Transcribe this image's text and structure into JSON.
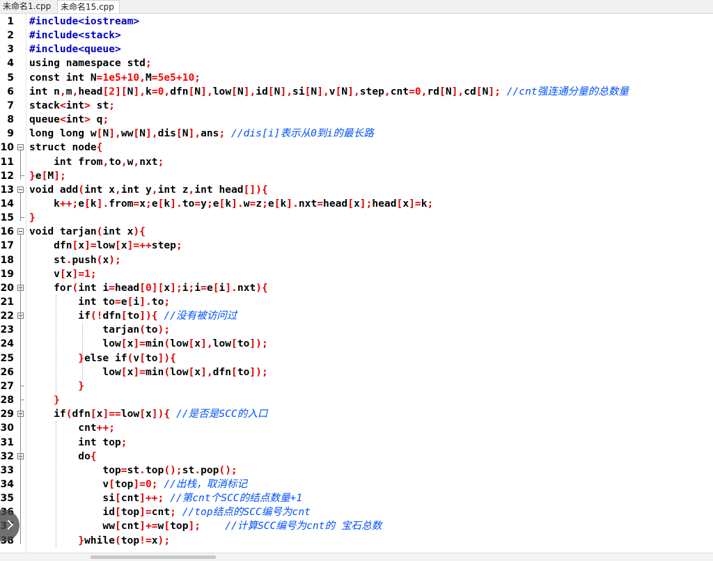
{
  "tabs": [
    "未命名1.cpp",
    "未命名15.cpp"
  ],
  "lines": [
    [
      [
        "p",
        "#include<iostream>"
      ]
    ],
    [
      [
        "p",
        "#include<stack>"
      ]
    ],
    [
      [
        "p",
        "#include<queue>"
      ]
    ],
    [
      [
        "k",
        "using namespace std"
      ],
      [
        "o",
        ";"
      ]
    ],
    [
      [
        "k",
        "const int "
      ],
      [
        "k",
        "N"
      ],
      [
        "o",
        "="
      ],
      [
        "n",
        "1e5+10"
      ],
      [
        "o",
        ","
      ],
      [
        "k",
        "M"
      ],
      [
        "o",
        "="
      ],
      [
        "n",
        "5e5+10"
      ],
      [
        "o",
        ";"
      ]
    ],
    [
      [
        "k",
        "int n"
      ],
      [
        "o",
        ","
      ],
      [
        "k",
        "m"
      ],
      [
        "o",
        ","
      ],
      [
        "k",
        "head"
      ],
      [
        "o",
        "["
      ],
      [
        "n",
        "2"
      ],
      [
        "o",
        "]["
      ],
      [
        "k",
        "N"
      ],
      [
        "o",
        "],"
      ],
      [
        "k",
        "k"
      ],
      [
        "o",
        "="
      ],
      [
        "n",
        "0"
      ],
      [
        "o",
        ","
      ],
      [
        "k",
        "dfn"
      ],
      [
        "o",
        "["
      ],
      [
        "k",
        "N"
      ],
      [
        "o",
        "],"
      ],
      [
        "k",
        "low"
      ],
      [
        "o",
        "["
      ],
      [
        "k",
        "N"
      ],
      [
        "o",
        "],"
      ],
      [
        "k",
        "id"
      ],
      [
        "o",
        "["
      ],
      [
        "k",
        "N"
      ],
      [
        "o",
        "],"
      ],
      [
        "k",
        "si"
      ],
      [
        "o",
        "["
      ],
      [
        "k",
        "N"
      ],
      [
        "o",
        "],"
      ],
      [
        "k",
        "v"
      ],
      [
        "o",
        "["
      ],
      [
        "k",
        "N"
      ],
      [
        "o",
        "],"
      ],
      [
        "k",
        "step"
      ],
      [
        "o",
        ","
      ],
      [
        "k",
        "cnt"
      ],
      [
        "o",
        "="
      ],
      [
        "n",
        "0"
      ],
      [
        "o",
        ","
      ],
      [
        "k",
        "rd"
      ],
      [
        "o",
        "["
      ],
      [
        "k",
        "N"
      ],
      [
        "o",
        "],"
      ],
      [
        "k",
        "cd"
      ],
      [
        "o",
        "["
      ],
      [
        "k",
        "N"
      ],
      [
        "o",
        "]; "
      ],
      [
        "c",
        "//cnt强连通分量的总数量"
      ]
    ],
    [
      [
        "k",
        "stack"
      ],
      [
        "o",
        "<"
      ],
      [
        "k",
        "int"
      ],
      [
        "o",
        "> "
      ],
      [
        "k",
        "st"
      ],
      [
        "o",
        ";"
      ]
    ],
    [
      [
        "k",
        "queue"
      ],
      [
        "o",
        "<"
      ],
      [
        "k",
        "int"
      ],
      [
        "o",
        "> "
      ],
      [
        "k",
        "q"
      ],
      [
        "o",
        ";"
      ]
    ],
    [
      [
        "k",
        "long long w"
      ],
      [
        "o",
        "["
      ],
      [
        "k",
        "N"
      ],
      [
        "o",
        "],"
      ],
      [
        "k",
        "ww"
      ],
      [
        "o",
        "["
      ],
      [
        "k",
        "N"
      ],
      [
        "o",
        "],"
      ],
      [
        "k",
        "dis"
      ],
      [
        "o",
        "["
      ],
      [
        "k",
        "N"
      ],
      [
        "o",
        "],"
      ],
      [
        "k",
        "ans"
      ],
      [
        "o",
        "; "
      ],
      [
        "c",
        "//dis[i]表示从0到i的最长路"
      ]
    ],
    [
      [
        "k",
        "struct node"
      ],
      [
        "o",
        "{"
      ]
    ],
    [
      [
        "k",
        "    int from"
      ],
      [
        "o",
        ","
      ],
      [
        "k",
        "to"
      ],
      [
        "o",
        ","
      ],
      [
        "k",
        "w"
      ],
      [
        "o",
        ","
      ],
      [
        "k",
        "nxt"
      ],
      [
        "o",
        ";"
      ]
    ],
    [
      [
        "o",
        "}"
      ],
      [
        "k",
        "e"
      ],
      [
        "o",
        "["
      ],
      [
        "k",
        "M"
      ],
      [
        "o",
        "];"
      ]
    ],
    [
      [
        "k",
        "void add"
      ],
      [
        "o",
        "("
      ],
      [
        "k",
        "int x"
      ],
      [
        "o",
        ","
      ],
      [
        "k",
        "int y"
      ],
      [
        "o",
        ","
      ],
      [
        "k",
        "int z"
      ],
      [
        "o",
        ","
      ],
      [
        "k",
        "int head"
      ],
      [
        "o",
        "[]){"
      ]
    ],
    [
      [
        "k",
        "    k"
      ],
      [
        "o",
        "++;"
      ],
      [
        "k",
        "e"
      ],
      [
        "o",
        "["
      ],
      [
        "k",
        "k"
      ],
      [
        "o",
        "]."
      ],
      [
        "k",
        "from"
      ],
      [
        "o",
        "="
      ],
      [
        "k",
        "x"
      ],
      [
        "o",
        ";"
      ],
      [
        "k",
        "e"
      ],
      [
        "o",
        "["
      ],
      [
        "k",
        "k"
      ],
      [
        "o",
        "]."
      ],
      [
        "k",
        "to"
      ],
      [
        "o",
        "="
      ],
      [
        "k",
        "y"
      ],
      [
        "o",
        ";"
      ],
      [
        "k",
        "e"
      ],
      [
        "o",
        "["
      ],
      [
        "k",
        "k"
      ],
      [
        "o",
        "]."
      ],
      [
        "k",
        "w"
      ],
      [
        "o",
        "="
      ],
      [
        "k",
        "z"
      ],
      [
        "o",
        ";"
      ],
      [
        "k",
        "e"
      ],
      [
        "o",
        "["
      ],
      [
        "k",
        "k"
      ],
      [
        "o",
        "]."
      ],
      [
        "k",
        "nxt"
      ],
      [
        "o",
        "="
      ],
      [
        "k",
        "head"
      ],
      [
        "o",
        "["
      ],
      [
        "k",
        "x"
      ],
      [
        "o",
        "];"
      ],
      [
        "k",
        "head"
      ],
      [
        "o",
        "["
      ],
      [
        "k",
        "x"
      ],
      [
        "o",
        "]="
      ],
      [
        "k",
        "k"
      ],
      [
        "o",
        ";"
      ]
    ],
    [
      [
        "o",
        "}"
      ]
    ],
    [
      [
        "k",
        "void tarjan"
      ],
      [
        "o",
        "("
      ],
      [
        "k",
        "int x"
      ],
      [
        "o",
        "){"
      ]
    ],
    [
      [
        "k",
        "    dfn"
      ],
      [
        "o",
        "["
      ],
      [
        "k",
        "x"
      ],
      [
        "o",
        "]="
      ],
      [
        "k",
        "low"
      ],
      [
        "o",
        "["
      ],
      [
        "k",
        "x"
      ],
      [
        "o",
        "]=++"
      ],
      [
        "k",
        "step"
      ],
      [
        "o",
        ";"
      ]
    ],
    [
      [
        "k",
        "    st"
      ],
      [
        "o",
        "."
      ],
      [
        "k",
        "push"
      ],
      [
        "o",
        "("
      ],
      [
        "k",
        "x"
      ],
      [
        "o",
        ");"
      ]
    ],
    [
      [
        "k",
        "    v"
      ],
      [
        "o",
        "["
      ],
      [
        "k",
        "x"
      ],
      [
        "o",
        "]="
      ],
      [
        "n",
        "1"
      ],
      [
        "o",
        ";"
      ]
    ],
    [
      [
        "k",
        "    for"
      ],
      [
        "o",
        "("
      ],
      [
        "k",
        "int i"
      ],
      [
        "o",
        "="
      ],
      [
        "k",
        "head"
      ],
      [
        "o",
        "["
      ],
      [
        "n",
        "0"
      ],
      [
        "o",
        "]["
      ],
      [
        "k",
        "x"
      ],
      [
        "o",
        "];"
      ],
      [
        "k",
        "i"
      ],
      [
        "o",
        ";"
      ],
      [
        "k",
        "i"
      ],
      [
        "o",
        "="
      ],
      [
        "k",
        "e"
      ],
      [
        "o",
        "["
      ],
      [
        "k",
        "i"
      ],
      [
        "o",
        "]."
      ],
      [
        "k",
        "nxt"
      ],
      [
        "o",
        "){"
      ]
    ],
    [
      [
        "k",
        "        int to"
      ],
      [
        "o",
        "="
      ],
      [
        "k",
        "e"
      ],
      [
        "o",
        "["
      ],
      [
        "k",
        "i"
      ],
      [
        "o",
        "]."
      ],
      [
        "k",
        "to"
      ],
      [
        "o",
        ";"
      ]
    ],
    [
      [
        "k",
        "        if"
      ],
      [
        "o",
        "(!"
      ],
      [
        "k",
        "dfn"
      ],
      [
        "o",
        "["
      ],
      [
        "k",
        "to"
      ],
      [
        "o",
        "]){ "
      ],
      [
        "c",
        "//没有被访问过"
      ]
    ],
    [
      [
        "k",
        "            tarjan"
      ],
      [
        "o",
        "("
      ],
      [
        "k",
        "to"
      ],
      [
        "o",
        ");"
      ]
    ],
    [
      [
        "k",
        "            low"
      ],
      [
        "o",
        "["
      ],
      [
        "k",
        "x"
      ],
      [
        "o",
        "]="
      ],
      [
        "k",
        "min"
      ],
      [
        "o",
        "("
      ],
      [
        "k",
        "low"
      ],
      [
        "o",
        "["
      ],
      [
        "k",
        "x"
      ],
      [
        "o",
        "],"
      ],
      [
        "k",
        "low"
      ],
      [
        "o",
        "["
      ],
      [
        "k",
        "to"
      ],
      [
        "o",
        "]);"
      ]
    ],
    [
      [
        "o",
        "        }"
      ],
      [
        "k",
        "else if"
      ],
      [
        "o",
        "("
      ],
      [
        "k",
        "v"
      ],
      [
        "o",
        "["
      ],
      [
        "k",
        "to"
      ],
      [
        "o",
        "]){"
      ]
    ],
    [
      [
        "k",
        "            low"
      ],
      [
        "o",
        "["
      ],
      [
        "k",
        "x"
      ],
      [
        "o",
        "]="
      ],
      [
        "k",
        "min"
      ],
      [
        "o",
        "("
      ],
      [
        "k",
        "low"
      ],
      [
        "o",
        "["
      ],
      [
        "k",
        "x"
      ],
      [
        "o",
        "],"
      ],
      [
        "k",
        "dfn"
      ],
      [
        "o",
        "["
      ],
      [
        "k",
        "to"
      ],
      [
        "o",
        "]);"
      ]
    ],
    [
      [
        "o",
        "        }"
      ]
    ],
    [
      [
        "o",
        "    }"
      ]
    ],
    [
      [
        "k",
        "    if"
      ],
      [
        "o",
        "("
      ],
      [
        "k",
        "dfn"
      ],
      [
        "o",
        "["
      ],
      [
        "k",
        "x"
      ],
      [
        "o",
        "]=="
      ],
      [
        "k",
        "low"
      ],
      [
        "o",
        "["
      ],
      [
        "k",
        "x"
      ],
      [
        "o",
        "]){ "
      ],
      [
        "c",
        "//是否是SCC的入口"
      ]
    ],
    [
      [
        "k",
        "        cnt"
      ],
      [
        "o",
        "++;"
      ]
    ],
    [
      [
        "k",
        "        int top"
      ],
      [
        "o",
        ";"
      ]
    ],
    [
      [
        "k",
        "        do"
      ],
      [
        "o",
        "{"
      ]
    ],
    [
      [
        "k",
        "            top"
      ],
      [
        "o",
        "="
      ],
      [
        "k",
        "st"
      ],
      [
        "o",
        "."
      ],
      [
        "k",
        "top"
      ],
      [
        "o",
        "();"
      ],
      [
        "k",
        "st"
      ],
      [
        "o",
        "."
      ],
      [
        "k",
        "pop"
      ],
      [
        "o",
        "();"
      ]
    ],
    [
      [
        "k",
        "            v"
      ],
      [
        "o",
        "["
      ],
      [
        "k",
        "top"
      ],
      [
        "o",
        "]="
      ],
      [
        "n",
        "0"
      ],
      [
        "o",
        "; "
      ],
      [
        "c",
        "//出栈，取消标记"
      ]
    ],
    [
      [
        "k",
        "            si"
      ],
      [
        "o",
        "["
      ],
      [
        "k",
        "cnt"
      ],
      [
        "o",
        "]++; "
      ],
      [
        "c",
        "//第cnt个SCC的结点数量+1"
      ]
    ],
    [
      [
        "k",
        "            id"
      ],
      [
        "o",
        "["
      ],
      [
        "k",
        "top"
      ],
      [
        "o",
        "]="
      ],
      [
        "k",
        "cnt"
      ],
      [
        "o",
        "; "
      ],
      [
        "c",
        "//top结点的SCC编号为cnt"
      ]
    ],
    [
      [
        "k",
        "            ww"
      ],
      [
        "o",
        "["
      ],
      [
        "k",
        "cnt"
      ],
      [
        "o",
        "]+="
      ],
      [
        "k",
        "w"
      ],
      [
        "o",
        "["
      ],
      [
        "k",
        "top"
      ],
      [
        "o",
        "];    "
      ],
      [
        "c",
        "//计算SCC编号为cnt的 宝石总数"
      ]
    ],
    [
      [
        "o",
        "        }"
      ],
      [
        "k",
        "while"
      ],
      [
        "o",
        "("
      ],
      [
        "k",
        "top"
      ],
      [
        "o",
        "!="
      ],
      [
        "k",
        "x"
      ],
      [
        "o",
        ");"
      ]
    ]
  ],
  "line_numbers": [
    "1",
    "2",
    "3",
    "4",
    "5",
    "6",
    "7",
    "8",
    "9",
    "10",
    "11",
    "12",
    "13",
    "14",
    "15",
    "16",
    "17",
    "18",
    "19",
    "20",
    "21",
    "22",
    "23",
    "24",
    "25",
    "26",
    "27",
    "28",
    "29",
    "30",
    "31",
    "32",
    "33",
    "34",
    "35",
    "36",
    "37",
    "38"
  ],
  "fold_markers": [
    10,
    13,
    16,
    20,
    22,
    29,
    32
  ],
  "colors": {
    "preprocessor": "#0000c8",
    "keyword": "#000000",
    "number": "#ff0000",
    "operator": "#e00000",
    "comment": "#0050ff"
  }
}
